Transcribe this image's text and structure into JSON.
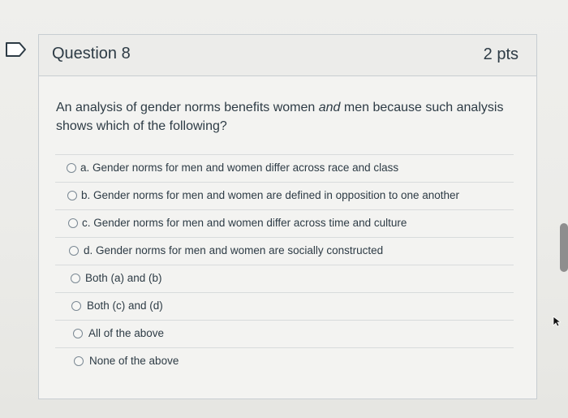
{
  "question": {
    "title": "Question 8",
    "points": "2 pts",
    "text_before": "An analysis of gender norms benefits women ",
    "text_emph": "and",
    "text_after": " men because such analysis shows which of the following?"
  },
  "answers": [
    {
      "label": "a. Gender norms for men and women differ across race and class"
    },
    {
      "label": "b. Gender norms for men and women are defined in opposition to one another"
    },
    {
      "label": "c. Gender norms for men and women differ across time and culture"
    },
    {
      "label": "d. Gender norms for men and women are socially constructed"
    },
    {
      "label": "Both (a) and (b)"
    },
    {
      "label": "Both (c) and (d)"
    },
    {
      "label": "All of the above"
    },
    {
      "label": "None of the above"
    }
  ],
  "colors": {
    "text": "#2d3b45",
    "border": "#c7cdd1",
    "radio": "#7a8893"
  }
}
